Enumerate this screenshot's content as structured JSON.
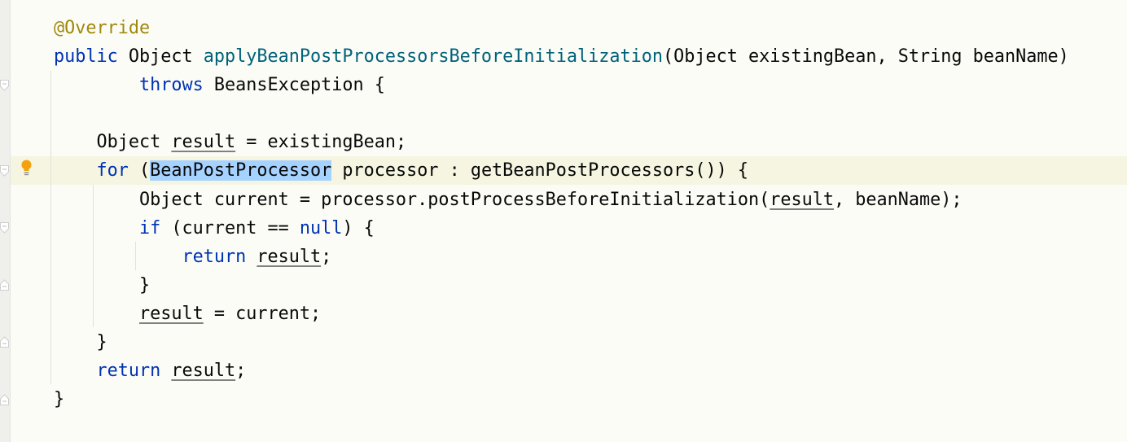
{
  "editor": {
    "colors": {
      "background": "#fcfcf7",
      "keyword": "#0033b3",
      "method": "#00627a",
      "annotation": "#9e880d",
      "selection": "#a6d2ff",
      "current_line": "#f5f5e1"
    },
    "gutter_icons": [
      "fold-marker",
      "intention-bulb-icon"
    ],
    "lines": [
      [
        {
          "t": "@Override",
          "c": "an"
        }
      ],
      [
        {
          "t": "public",
          "c": "kw"
        },
        {
          "t": " Object "
        },
        {
          "t": "applyBeanPostProcessorsBeforeInitialization",
          "c": "fn"
        },
        {
          "t": "(Object existingBean, String beanName)"
        }
      ],
      [
        {
          "t": "        "
        },
        {
          "t": "throws",
          "c": "kw"
        },
        {
          "t": " BeansException {"
        }
      ],
      [],
      [
        {
          "t": "    Object "
        },
        {
          "t": "result",
          "c": "ul"
        },
        {
          "t": " = existingBean;"
        }
      ],
      [
        {
          "t": "    "
        },
        {
          "t": "for",
          "c": "kw"
        },
        {
          "t": " ("
        },
        {
          "t": "BeanPostProcessor",
          "c": "sel"
        },
        {
          "t": " processor : getBeanPostProcessors()) {"
        }
      ],
      [
        {
          "t": "        Object current = processor.postProcessBeforeInitialization("
        },
        {
          "t": "result",
          "c": "ul"
        },
        {
          "t": ", beanName);"
        }
      ],
      [
        {
          "t": "        "
        },
        {
          "t": "if",
          "c": "kw"
        },
        {
          "t": " (current == "
        },
        {
          "t": "null",
          "c": "kw"
        },
        {
          "t": ") {"
        }
      ],
      [
        {
          "t": "            "
        },
        {
          "t": "return",
          "c": "kw"
        },
        {
          "t": " "
        },
        {
          "t": "result",
          "c": "ul"
        },
        {
          "t": ";"
        }
      ],
      [
        {
          "t": "        }"
        }
      ],
      [
        {
          "t": "        "
        },
        {
          "t": "result",
          "c": "ul"
        },
        {
          "t": " = current;"
        }
      ],
      [
        {
          "t": "    }"
        }
      ],
      [
        {
          "t": "    "
        },
        {
          "t": "return",
          "c": "kw"
        },
        {
          "t": " "
        },
        {
          "t": "result",
          "c": "ul"
        },
        {
          "t": ";"
        }
      ],
      [
        {
          "t": "}"
        }
      ]
    ]
  }
}
